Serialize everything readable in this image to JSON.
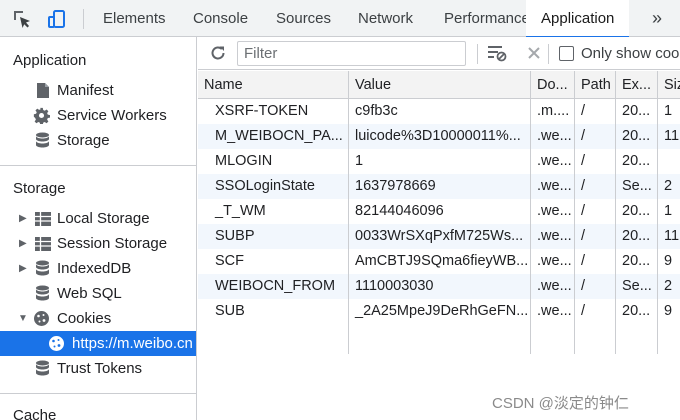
{
  "toolbar_tabs": [
    "Elements",
    "Console",
    "Sources",
    "Network",
    "Performance",
    "Application"
  ],
  "more_tabs_glyph": "»",
  "sidebar": {
    "application_title": "Application",
    "application_items": [
      "Manifest",
      "Service Workers",
      "Storage"
    ],
    "storage_title": "Storage",
    "storage_items": [
      "Local Storage",
      "Session Storage",
      "IndexedDB",
      "Web SQL",
      "Cookies"
    ],
    "cookie_origin": "https://m.weibo.cn",
    "trust_tokens": "Trust Tokens",
    "cache_title": "Cache"
  },
  "cookie_toolbar": {
    "filter_placeholder": "Filter",
    "only_show_label": "Only show coo"
  },
  "table": {
    "headers": [
      "Name",
      "Value",
      "Do...",
      "Path",
      "Ex...",
      "Siz"
    ],
    "rows": [
      [
        "XSRF-TOKEN",
        "c9fb3c",
        ".m....",
        "/",
        "20...",
        "1"
      ],
      [
        "M_WEIBOCN_PA...",
        "luicode%3D10000011%...",
        ".we...",
        "/",
        "20...",
        "11"
      ],
      [
        "MLOGIN",
        "1",
        ".we...",
        "/",
        "20...",
        ""
      ],
      [
        "SSOLoginState",
        "1637978669",
        ".we...",
        "/",
        "Se...",
        "2"
      ],
      [
        "_T_WM",
        "82144046096",
        ".we...",
        "/",
        "20...",
        "1"
      ],
      [
        "SUBP",
        "0033WrSXqPxfM725Ws...",
        ".we...",
        "/",
        "20...",
        "11"
      ],
      [
        "SCF",
        "AmCBTJ9SQma6fieyWB...",
        ".we...",
        "/",
        "20...",
        "9"
      ],
      [
        "WEIBOCN_FROM",
        "1110003030",
        ".we...",
        "/",
        "Se...",
        "2"
      ],
      [
        "SUB",
        "_2A25MpeJ9DeRhGeFN...",
        ".we...",
        "/",
        "20...",
        "9"
      ]
    ]
  },
  "watermark": "CSDN @淡定的钟仁",
  "colors": {
    "accent": "#1a73e8",
    "selected_row_bg": "#1a73e8",
    "alt_row_bg": "#f2f7fd"
  }
}
